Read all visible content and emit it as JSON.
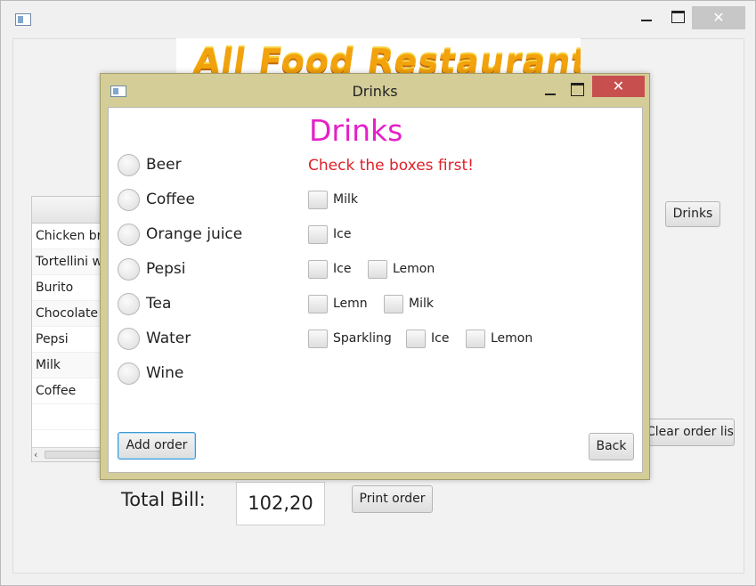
{
  "main_window": {
    "close_glyph": "✕",
    "banner_text": "All Food Restaurant",
    "order_list": [
      "Chicken breast",
      "Tortellini with",
      "Burito",
      "Chocolate cake",
      "Pepsi",
      "Milk",
      "Coffee"
    ],
    "drinks_button": "Drinks",
    "clear_button": "Clear order list",
    "total_label": "Total Bill:",
    "total_value": "102,20",
    "print_button": "Print order"
  },
  "dialog": {
    "title": "Drinks",
    "close_glyph": "✕",
    "heading": "Drinks",
    "hint": "Check the boxes first!",
    "drinks": [
      "Beer",
      "Coffee",
      "Orange juice",
      "Pepsi",
      "Tea",
      "Water",
      "Wine"
    ],
    "options": {
      "coffee": [
        "Milk"
      ],
      "orange_juice": [
        "Ice"
      ],
      "pepsi": [
        "Ice",
        "Lemon"
      ],
      "tea": [
        "Lemn",
        "Milk"
      ],
      "water": [
        "Sparkling",
        "Ice",
        "Lemon"
      ]
    },
    "add_button": "Add order",
    "back_button": "Back"
  },
  "colors": {
    "dialog_frame": "#d4cd98",
    "heading": "#e620c8",
    "hint": "#e0202a",
    "close_button": "#c7504f"
  }
}
